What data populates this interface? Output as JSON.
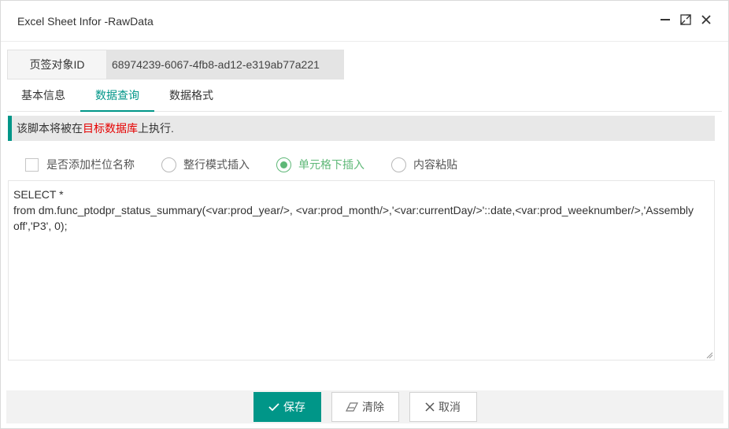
{
  "window": {
    "title": "Excel Sheet Infor -RawData"
  },
  "id_row": {
    "label": "页签对象ID",
    "value": "68974239-6067-4fb8-ad12-e319ab77a221"
  },
  "tabs": [
    {
      "label": "基本信息",
      "active": false
    },
    {
      "label": "数据查询",
      "active": true
    },
    {
      "label": "数据格式",
      "active": false
    }
  ],
  "notice": {
    "prefix": "该脚本将被在",
    "highlight": "目标数据库",
    "suffix": "上执行."
  },
  "options": {
    "add_column_names": {
      "label": "是否添加栏位名称",
      "checked": false
    },
    "row_mode_insert": {
      "label": "整行模式插入",
      "selected": false
    },
    "cell_down_insert": {
      "label": "单元格下插入",
      "selected": true
    },
    "content_paste": {
      "label": "内容粘贴",
      "selected": false
    }
  },
  "query": {
    "text": "SELECT *\nfrom dm.func_ptodpr_status_summary(<var:prod_year/>, <var:prod_month/>,'<var:currentDay/>'::date,<var:prod_weeknumber/>,'Assembly off','P3', 0);"
  },
  "footer": {
    "save_label": "保存",
    "clear_label": "清除",
    "cancel_label": "取消"
  },
  "colors": {
    "accent": "#009688",
    "radio_selected": "#5fb878",
    "highlight_text": "#e60000"
  }
}
